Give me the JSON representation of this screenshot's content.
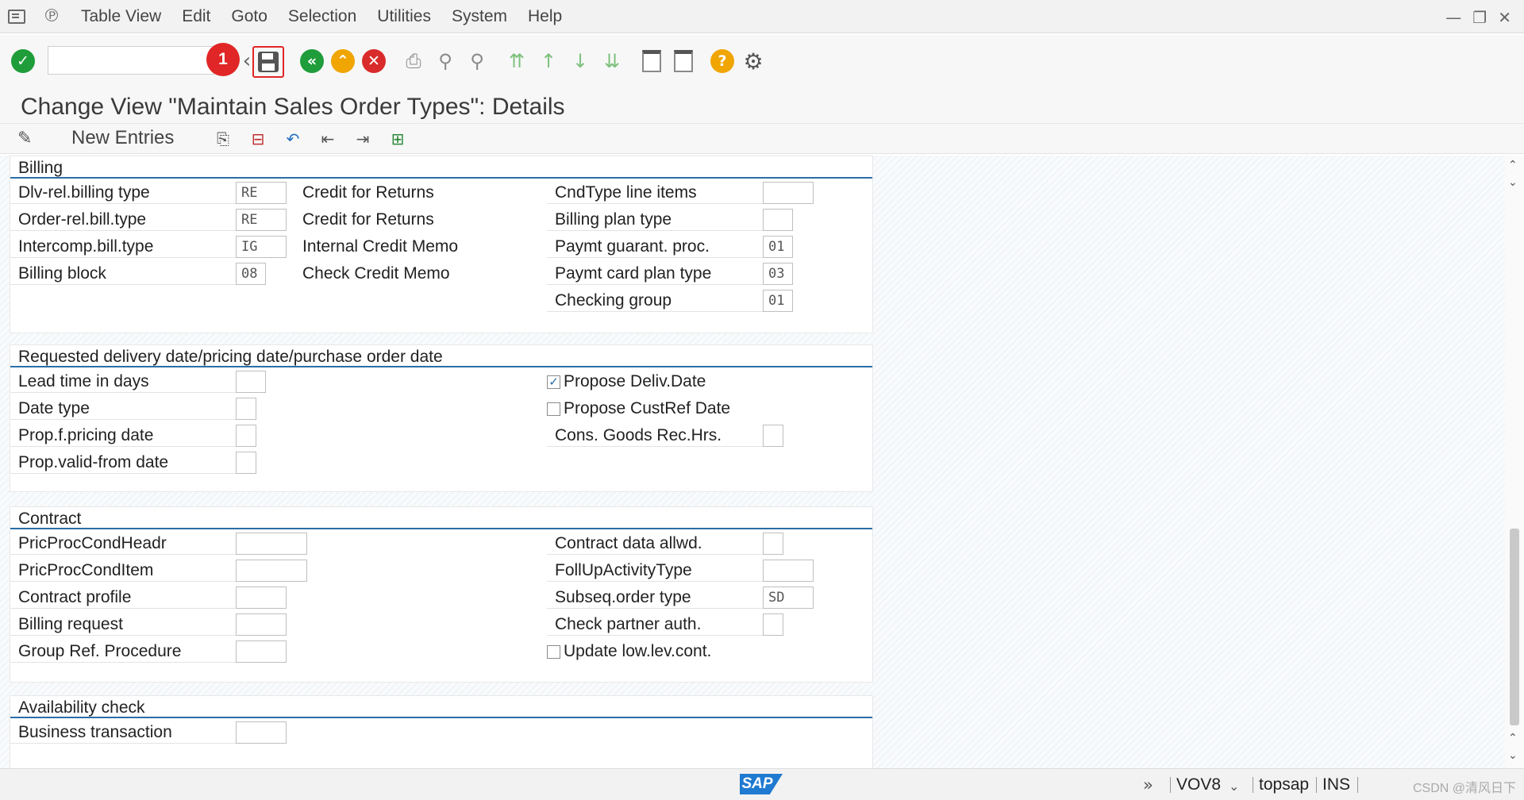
{
  "menu": {
    "items": [
      "Table View",
      "Edit",
      "Goto",
      "Selection",
      "Utilities",
      "System",
      "Help"
    ]
  },
  "toolbar": {
    "command_field_value": "",
    "badge_number": "1"
  },
  "page": {
    "title": "Change View \"Maintain Sales Order Types\": Details",
    "new_entries_label": "New Entries"
  },
  "billing": {
    "title": "Billing",
    "rows": [
      {
        "label": "Dlv-rel.billing type",
        "value": "RE",
        "desc": "Credit for Returns"
      },
      {
        "label": "Order-rel.bill.type",
        "value": "RE",
        "desc": "Credit for Returns"
      },
      {
        "label": "Intercomp.bill.type",
        "value": "IG",
        "desc": "Internal Credit Memo"
      },
      {
        "label": "Billing block",
        "value": "08",
        "desc": "Check Credit Memo"
      }
    ],
    "right_rows": [
      {
        "label": "CndType line items",
        "value": ""
      },
      {
        "label": "Billing plan type",
        "value": ""
      },
      {
        "label": "Paymt guarant. proc.",
        "value": "01"
      },
      {
        "label": "Paymt card plan type",
        "value": "03"
      },
      {
        "label": "Checking group",
        "value": "01"
      }
    ]
  },
  "delivery_dates": {
    "title": "Requested delivery date/pricing date/purchase order date",
    "rows": [
      {
        "label": "Lead time in days",
        "value": ""
      },
      {
        "label": "Date type",
        "value": ""
      },
      {
        "label": "Prop.f.pricing date",
        "value": ""
      },
      {
        "label": "Prop.valid-from date",
        "value": ""
      }
    ],
    "checkboxes": [
      {
        "label": "Propose Deliv.Date",
        "checked": true,
        "mark": "✓"
      },
      {
        "label": "Propose CustRef Date",
        "checked": false,
        "mark": ""
      }
    ],
    "cons_goods_label": "Cons. Goods Rec.Hrs.",
    "cons_goods_value": ""
  },
  "contract": {
    "title": "Contract",
    "rows": [
      {
        "label": "PricProcCondHeadr",
        "value": ""
      },
      {
        "label": "PricProcCondItem",
        "value": ""
      },
      {
        "label": "Contract profile",
        "value": ""
      },
      {
        "label": "Billing request",
        "value": ""
      },
      {
        "label": "Group Ref. Procedure",
        "value": ""
      }
    ],
    "right_rows": [
      {
        "label": "Contract data allwd.",
        "value": ""
      },
      {
        "label": "FollUpActivityType",
        "value": ""
      },
      {
        "label": "Subseq.order type",
        "value": "SD"
      },
      {
        "label": "Check partner auth.",
        "value": ""
      }
    ],
    "checkbox": {
      "label": "Update low.lev.cont.",
      "checked": false,
      "mark": ""
    }
  },
  "availability": {
    "title": "Availability check",
    "rows": [
      {
        "label": "Business transaction",
        "value": ""
      }
    ]
  },
  "status": {
    "transaction": "VOV8",
    "server": "topsap",
    "mode": "INS",
    "sap_logo": "SAP",
    "watermark": "CSDN @清风日下"
  }
}
